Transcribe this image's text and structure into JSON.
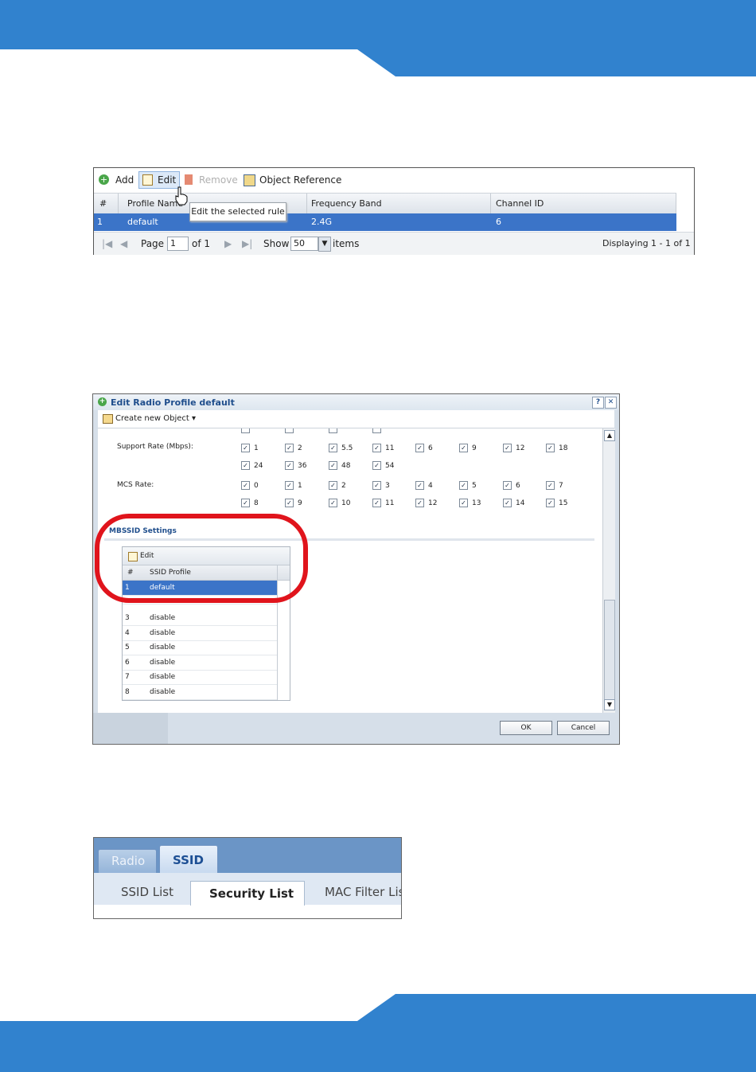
{
  "colors": {
    "band": "#3182ce",
    "selected_row": "#3b74c8",
    "highlight_ring": "#e0141c"
  },
  "grid_panel": {
    "toolbar": {
      "add": "Add",
      "edit": "Edit",
      "remove": "Remove",
      "object_reference": "Object Reference"
    },
    "tooltip": "Edit the selected rule",
    "columns": [
      "#",
      "Profile Name",
      "Frequency Band",
      "Channel ID"
    ],
    "rows": [
      {
        "num": "1",
        "profile": "default",
        "band": "2.4G",
        "channel": "6"
      }
    ],
    "pager": {
      "page_label": "Page",
      "page_value": "1",
      "of_label": "of 1",
      "show_label": "Show",
      "show_value": "50",
      "items_label": "items",
      "displaying": "Displaying 1 - 1 of 1"
    }
  },
  "dialog": {
    "title": "Edit Radio Profile default",
    "help": "?",
    "close": "✕",
    "create_object": "Create new Object ▾",
    "support_rate_label": "Support Rate (Mbps):",
    "support_rates": [
      "1",
      "2",
      "5.5",
      "11",
      "6",
      "9",
      "12",
      "18",
      "24",
      "36",
      "48",
      "54"
    ],
    "mcs_label": "MCS Rate:",
    "mcs_rates": [
      "0",
      "1",
      "2",
      "3",
      "4",
      "5",
      "6",
      "7",
      "8",
      "9",
      "10",
      "11",
      "12",
      "13",
      "14",
      "15"
    ],
    "mbssid_title": "MBSSID Settings",
    "ssid_edit": "Edit",
    "ssid_columns": [
      "#",
      "SSID Profile"
    ],
    "ssid_rows": [
      {
        "num": "1",
        "profile": "default"
      },
      {
        "num": "3",
        "profile": "disable"
      },
      {
        "num": "4",
        "profile": "disable"
      },
      {
        "num": "5",
        "profile": "disable"
      },
      {
        "num": "6",
        "profile": "disable"
      },
      {
        "num": "7",
        "profile": "disable"
      },
      {
        "num": "8",
        "profile": "disable"
      }
    ],
    "ok": "OK",
    "cancel": "Cancel"
  },
  "tabs_panel": {
    "top_tabs": [
      "Radio",
      "SSID"
    ],
    "sub_tabs": [
      "SSID List",
      "Security List",
      "MAC Filter List"
    ]
  }
}
